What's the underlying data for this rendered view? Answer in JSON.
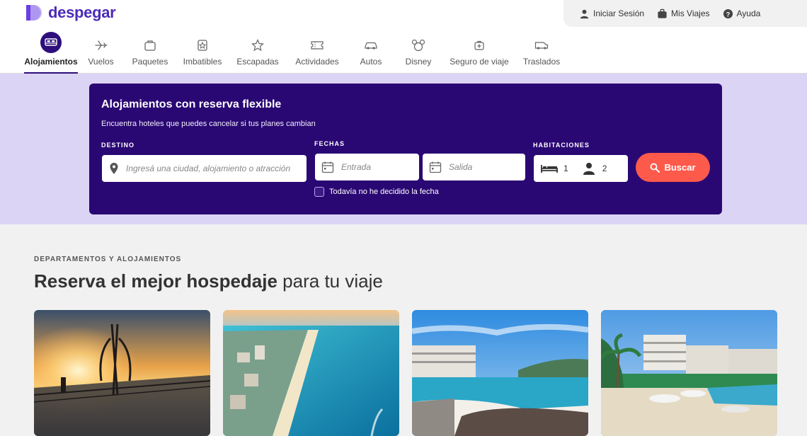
{
  "brand": {
    "name": "despegar",
    "color": "#4b2bb8"
  },
  "userbar": {
    "login": "Iniciar Sesión",
    "trips": "Mis Viajes",
    "help": "Ayuda"
  },
  "nav": {
    "items": [
      {
        "label": "Alojamientos",
        "icon": "bed-icon",
        "active": true
      },
      {
        "label": "Vuelos",
        "icon": "plane-icon"
      },
      {
        "label": "Paquetes",
        "icon": "suitcase-icon"
      },
      {
        "label": "Imbatibles",
        "icon": "badge-icon"
      },
      {
        "label": "Escapadas",
        "icon": "star-icon"
      },
      {
        "label": "Actividades",
        "icon": "ticket-icon"
      },
      {
        "label": "Autos",
        "icon": "car-icon"
      },
      {
        "label": "Disney",
        "icon": "mickey-icon"
      },
      {
        "label": "Seguro de viaje",
        "icon": "medical-bag-icon"
      },
      {
        "label": "Traslados",
        "icon": "van-icon"
      }
    ]
  },
  "search": {
    "title": "Alojamientos con reserva flexible",
    "subtitle": "Encuentra hoteles que puedes cancelar si tus planes cambian",
    "destination_label": "DESTINO",
    "destination_placeholder": "Ingresá una ciudad, alojamiento o atracción",
    "dates_label": "FECHAS",
    "checkin_placeholder": "Entrada",
    "checkout_placeholder": "Salida",
    "undecided_label": "Todavía no he decidido la fecha",
    "rooms_label": "HABITACIONES",
    "rooms_count": "1",
    "guests_count": "2",
    "button_label": "Buscar",
    "button_color": "#fd5a4c",
    "card_color": "#2a0873"
  },
  "section": {
    "eyebrow": "DEPARTAMENTOS Y ALOJAMIENTOS",
    "title_bold": "Reserva el mejor hospedaje",
    "title_rest": " para tu viaje"
  }
}
